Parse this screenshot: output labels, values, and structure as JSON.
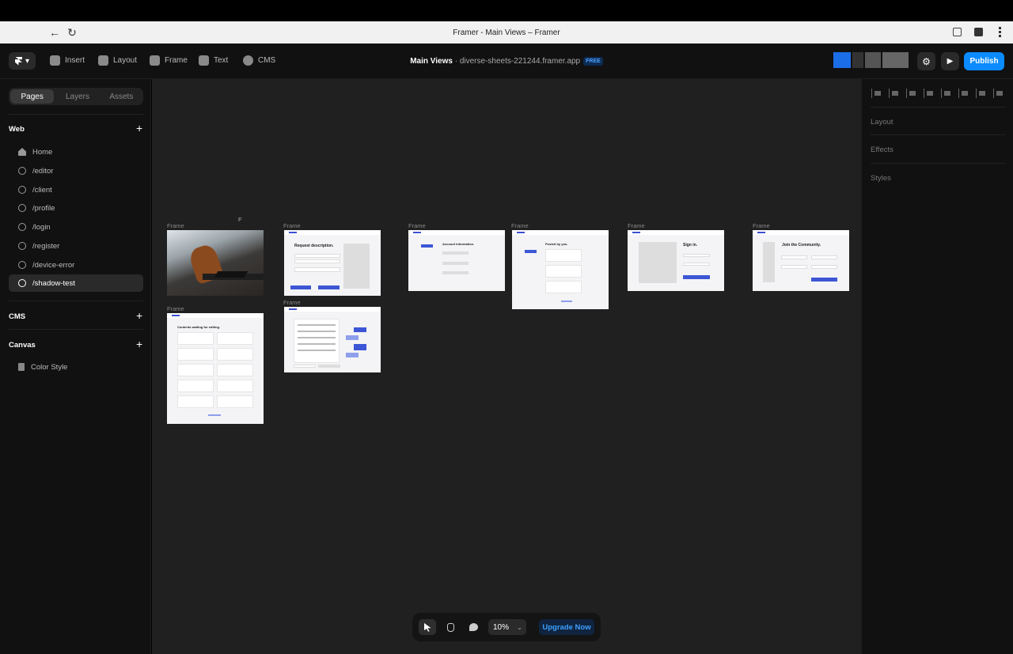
{
  "browser": {
    "tab_title": "Framer - Main Views – Framer",
    "back_glyph": "←",
    "reload_glyph": "↻"
  },
  "toolbar": {
    "logo_glyph": "▾",
    "items": [
      {
        "label": "Insert",
        "icon": "plus-icon"
      },
      {
        "label": "Layout",
        "icon": "layout-icon"
      },
      {
        "label": "Frame",
        "icon": "frame-icon"
      },
      {
        "label": "Text",
        "icon": "text-icon"
      },
      {
        "label": "CMS",
        "icon": "database-icon"
      }
    ],
    "project_name": "Main Views",
    "separator": " · ",
    "domain": "diverse-sheets-221244.framer.app",
    "plan_badge": "FREE",
    "settings_glyph": "⚙",
    "play_glyph": "▶",
    "publish_label": "Publish"
  },
  "sidebar": {
    "tabs": [
      {
        "label": "Pages",
        "active": true
      },
      {
        "label": "Layers",
        "active": false
      },
      {
        "label": "Assets",
        "active": false
      }
    ],
    "web_heading": "Web",
    "pages": [
      {
        "label": "Home",
        "icon": "home-icon",
        "selected": false
      },
      {
        "label": "/editor",
        "icon": "globe-icon",
        "selected": false
      },
      {
        "label": "/client",
        "icon": "globe-icon",
        "selected": false
      },
      {
        "label": "/profile",
        "icon": "globe-icon",
        "selected": false
      },
      {
        "label": "/login",
        "icon": "globe-icon",
        "selected": false
      },
      {
        "label": "/register",
        "icon": "globe-icon",
        "selected": false
      },
      {
        "label": "/device-error",
        "icon": "globe-icon",
        "selected": false
      },
      {
        "label": "/shadow-test",
        "icon": "globe-icon",
        "selected": true
      }
    ],
    "cms_heading": "CMS",
    "canvas_heading": "Canvas",
    "canvas_items": [
      {
        "label": "Color Style",
        "icon": "document-icon"
      }
    ],
    "plus_glyph": "+"
  },
  "canvas": {
    "cursor_letter": "F",
    "frame_label": "Frame",
    "frames": {
      "request_title": "Request description.",
      "account_title": "Account information.",
      "posted_title": "Posted by you.",
      "signin_title": "Sign in.",
      "join_title": "Join the Community.",
      "contents_title": "Contents waiting for editing."
    }
  },
  "right_panel": {
    "sections": [
      "Layout",
      "Effects",
      "Styles"
    ]
  },
  "bottom_bar": {
    "zoom": "10%",
    "zoom_chevron": "⌄",
    "upgrade_label": "Upgrade Now"
  },
  "colors": {
    "accent": "#0b8bff",
    "canvas_bg": "#202020",
    "panel_bg": "#111111"
  }
}
